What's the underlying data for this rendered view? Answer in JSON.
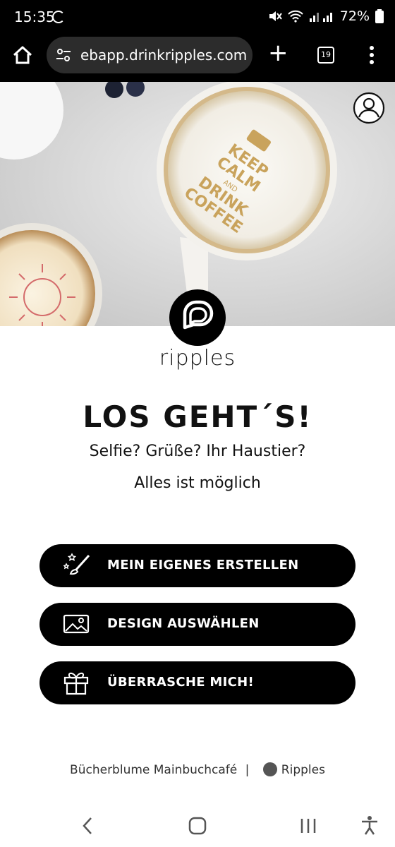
{
  "status_bar": {
    "time": "15:35",
    "battery": "72%"
  },
  "browser": {
    "url": "ebapp.drinkripples.com",
    "tab_count": "19"
  },
  "hero": {
    "cup_text": "KEEP CALM AND DRINK COFFEE"
  },
  "brand": {
    "name": "ripples"
  },
  "intro": {
    "title": "LOS GEHT´S!",
    "subtitle_line1": "Selfie? Grüße? Ihr Haustier?",
    "subtitle_line2": "Alles ist möglich"
  },
  "actions": [
    {
      "label": "MEIN EIGENES ERSTELLEN",
      "icon": "magic-brush-icon"
    },
    {
      "label": "DESIGN AUSWÄHLEN",
      "icon": "image-icon"
    },
    {
      "label": "ÜBERRASCHE MICH!",
      "icon": "gift-icon"
    }
  ],
  "footer": {
    "venue": "Bücherblume Mainbuchcafé",
    "separator": "|",
    "brand": "Ripples"
  }
}
